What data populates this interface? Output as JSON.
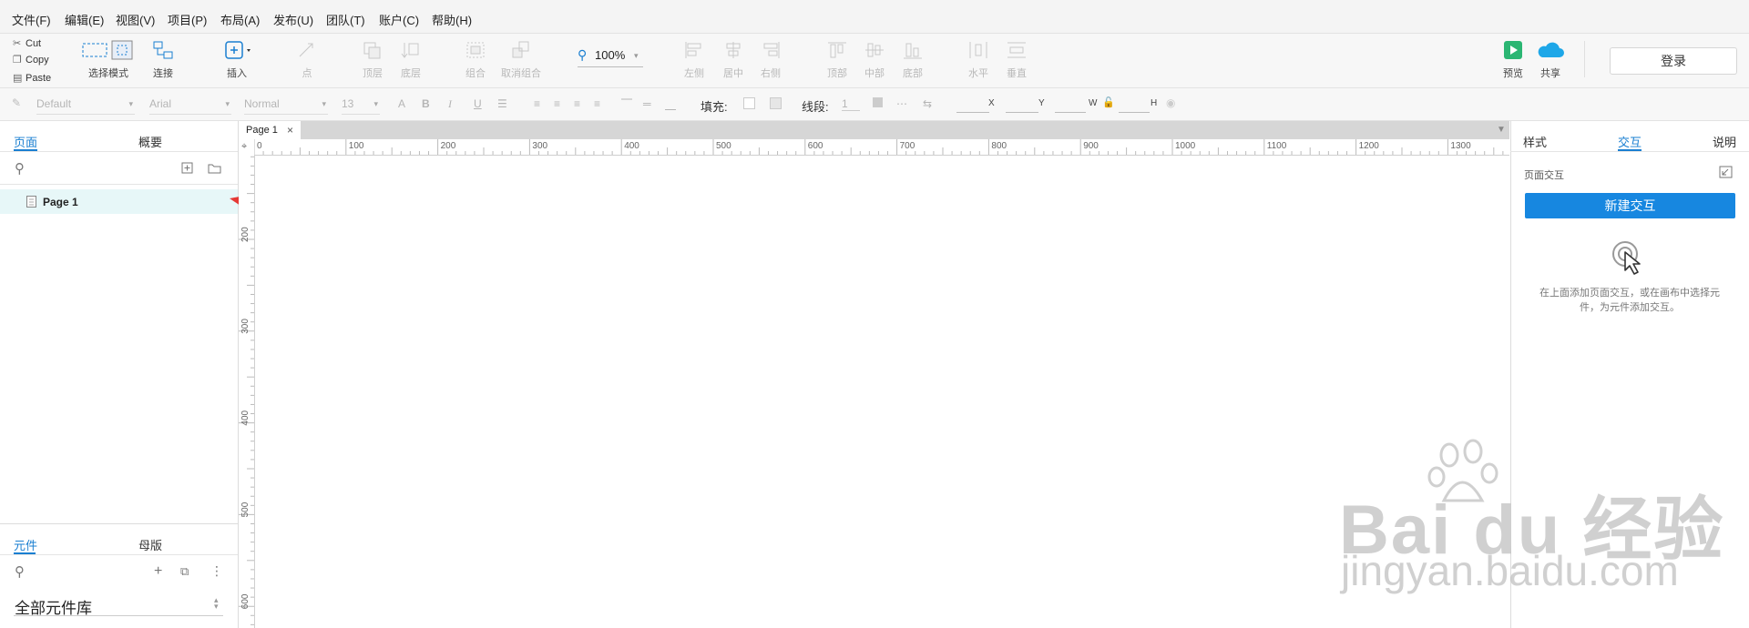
{
  "menubar": {
    "items": [
      "文件(F)",
      "编辑(E)",
      "视图(V)",
      "项目(P)",
      "布局(A)",
      "发布(U)",
      "团队(T)",
      "账户(C)",
      "帮助(H)"
    ]
  },
  "toolbar": {
    "clipboard": [
      "Cut",
      "Copy",
      "Paste"
    ],
    "select_mode": "选择模式",
    "connect": "连接",
    "insert": "插入",
    "point": "点",
    "top_layer": "顶层",
    "bottom_layer": "底层",
    "group": "组合",
    "ungroup": "取消组合",
    "zoom": "100%",
    "align_left": "左侧",
    "align_center": "居中",
    "align_right": "右侧",
    "align_top": "顶部",
    "align_middle": "中部",
    "align_bottom": "底部",
    "distribute_h": "水平",
    "distribute_v": "垂直",
    "preview": "预览",
    "share": "共享",
    "login": "登录"
  },
  "formatbar": {
    "style": "Default",
    "font": "Arial",
    "weight": "Normal",
    "size": "13",
    "fill_label": "填充:",
    "stroke_label": "线段:",
    "stroke_width": "1",
    "x_label": "X",
    "y_label": "Y",
    "w_label": "W",
    "h_label": "H"
  },
  "left": {
    "tabs": [
      "页面",
      "概要"
    ],
    "pages": [
      "Page 1"
    ],
    "bottom_tabs": [
      "元件",
      "母版"
    ],
    "library": "全部元件库"
  },
  "canvas": {
    "tab": "Page 1",
    "ruler_h": [
      "0",
      "100",
      "200",
      "300",
      "400",
      "500",
      "600",
      "700",
      "800",
      "900",
      "1000",
      "1100",
      "1200",
      "1300"
    ],
    "ruler_v": [
      "200",
      "300",
      "400",
      "500",
      "600"
    ]
  },
  "right": {
    "tabs": [
      "样式",
      "交互",
      "说明"
    ],
    "section": "页面交互",
    "new_button": "新建交互",
    "hint_line1": "在上面添加页面交互，或在画布中选择元",
    "hint_line2": "件，为元件添加交互。"
  },
  "watermark": {
    "brand": "Bai du 经验",
    "url": "jingyan.baidu.com"
  },
  "colors": {
    "accent": "#1a7fd1",
    "button": "#1787e0",
    "arrow": "#e53935",
    "preview_green": "#2bb673",
    "share_blue": "#1ea7e8"
  }
}
